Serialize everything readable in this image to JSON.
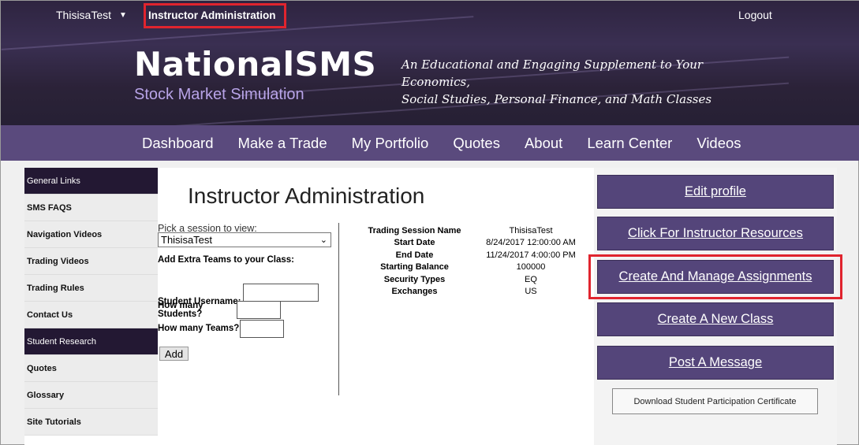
{
  "topbar": {
    "username": "ThisisaTest",
    "instructor_admin": "Instructor Administration",
    "logout": "Logout"
  },
  "brand": {
    "name": "NationalSMS",
    "subtitle": "Stock Market Simulation",
    "tagline_1": "An Educational and Engaging Supplement to Your Economics,",
    "tagline_2": "Social Studies, Personal Finance, and Math Classes"
  },
  "mainnav": [
    "Dashboard",
    "Make a Trade",
    "My Portfolio",
    "Quotes",
    "About",
    "Learn Center",
    "Videos"
  ],
  "leftnav": [
    {
      "label": "General Links",
      "section": true
    },
    {
      "label": "SMS FAQS",
      "section": false
    },
    {
      "label": "Navigation Videos",
      "section": false
    },
    {
      "label": "Trading Videos",
      "section": false
    },
    {
      "label": "Trading Rules",
      "section": false
    },
    {
      "label": "Contact Us",
      "section": false
    },
    {
      "label": "Student Research",
      "section": true
    },
    {
      "label": "Quotes",
      "section": false
    },
    {
      "label": "Glossary",
      "section": false
    },
    {
      "label": "Site Tutorials",
      "section": false
    }
  ],
  "main": {
    "title": "Instructor Administration",
    "pick_label": "Pick a session to view:",
    "session_selected": "ThisisaTest",
    "extra_teams_label": "Add Extra Teams to your Class:",
    "student_username_label": "Student Username:",
    "how_many_students_label_1": "How many",
    "how_many_students_label_2": "Students?",
    "how_many_teams_label": "How many Teams?",
    "add_button": "Add"
  },
  "session_info": [
    {
      "key": "Trading Session Name",
      "value": "ThisisaTest"
    },
    {
      "key": "Start Date",
      "value": "8/24/2017 12:00:00 AM"
    },
    {
      "key": "End Date",
      "value": "11/24/2017 4:00:00 PM"
    },
    {
      "key": "Starting Balance",
      "value": "100000"
    },
    {
      "key": "Security Types",
      "value": "EQ"
    },
    {
      "key": "Exchanges",
      "value": "US"
    }
  ],
  "actions": {
    "edit_profile": "Edit profile",
    "instructor_resources": "Click For Instructor Resources",
    "manage_assignments": "Create And Manage Assignments",
    "new_class": "Create A New Class",
    "post_message": "Post A Message",
    "certificate": "Download Student Participation Certificate"
  },
  "colors": {
    "nav_purple": "#5a4a7d",
    "button_purple": "#54457a",
    "highlight_red": "#e0242e",
    "section_dark": "#231833"
  }
}
